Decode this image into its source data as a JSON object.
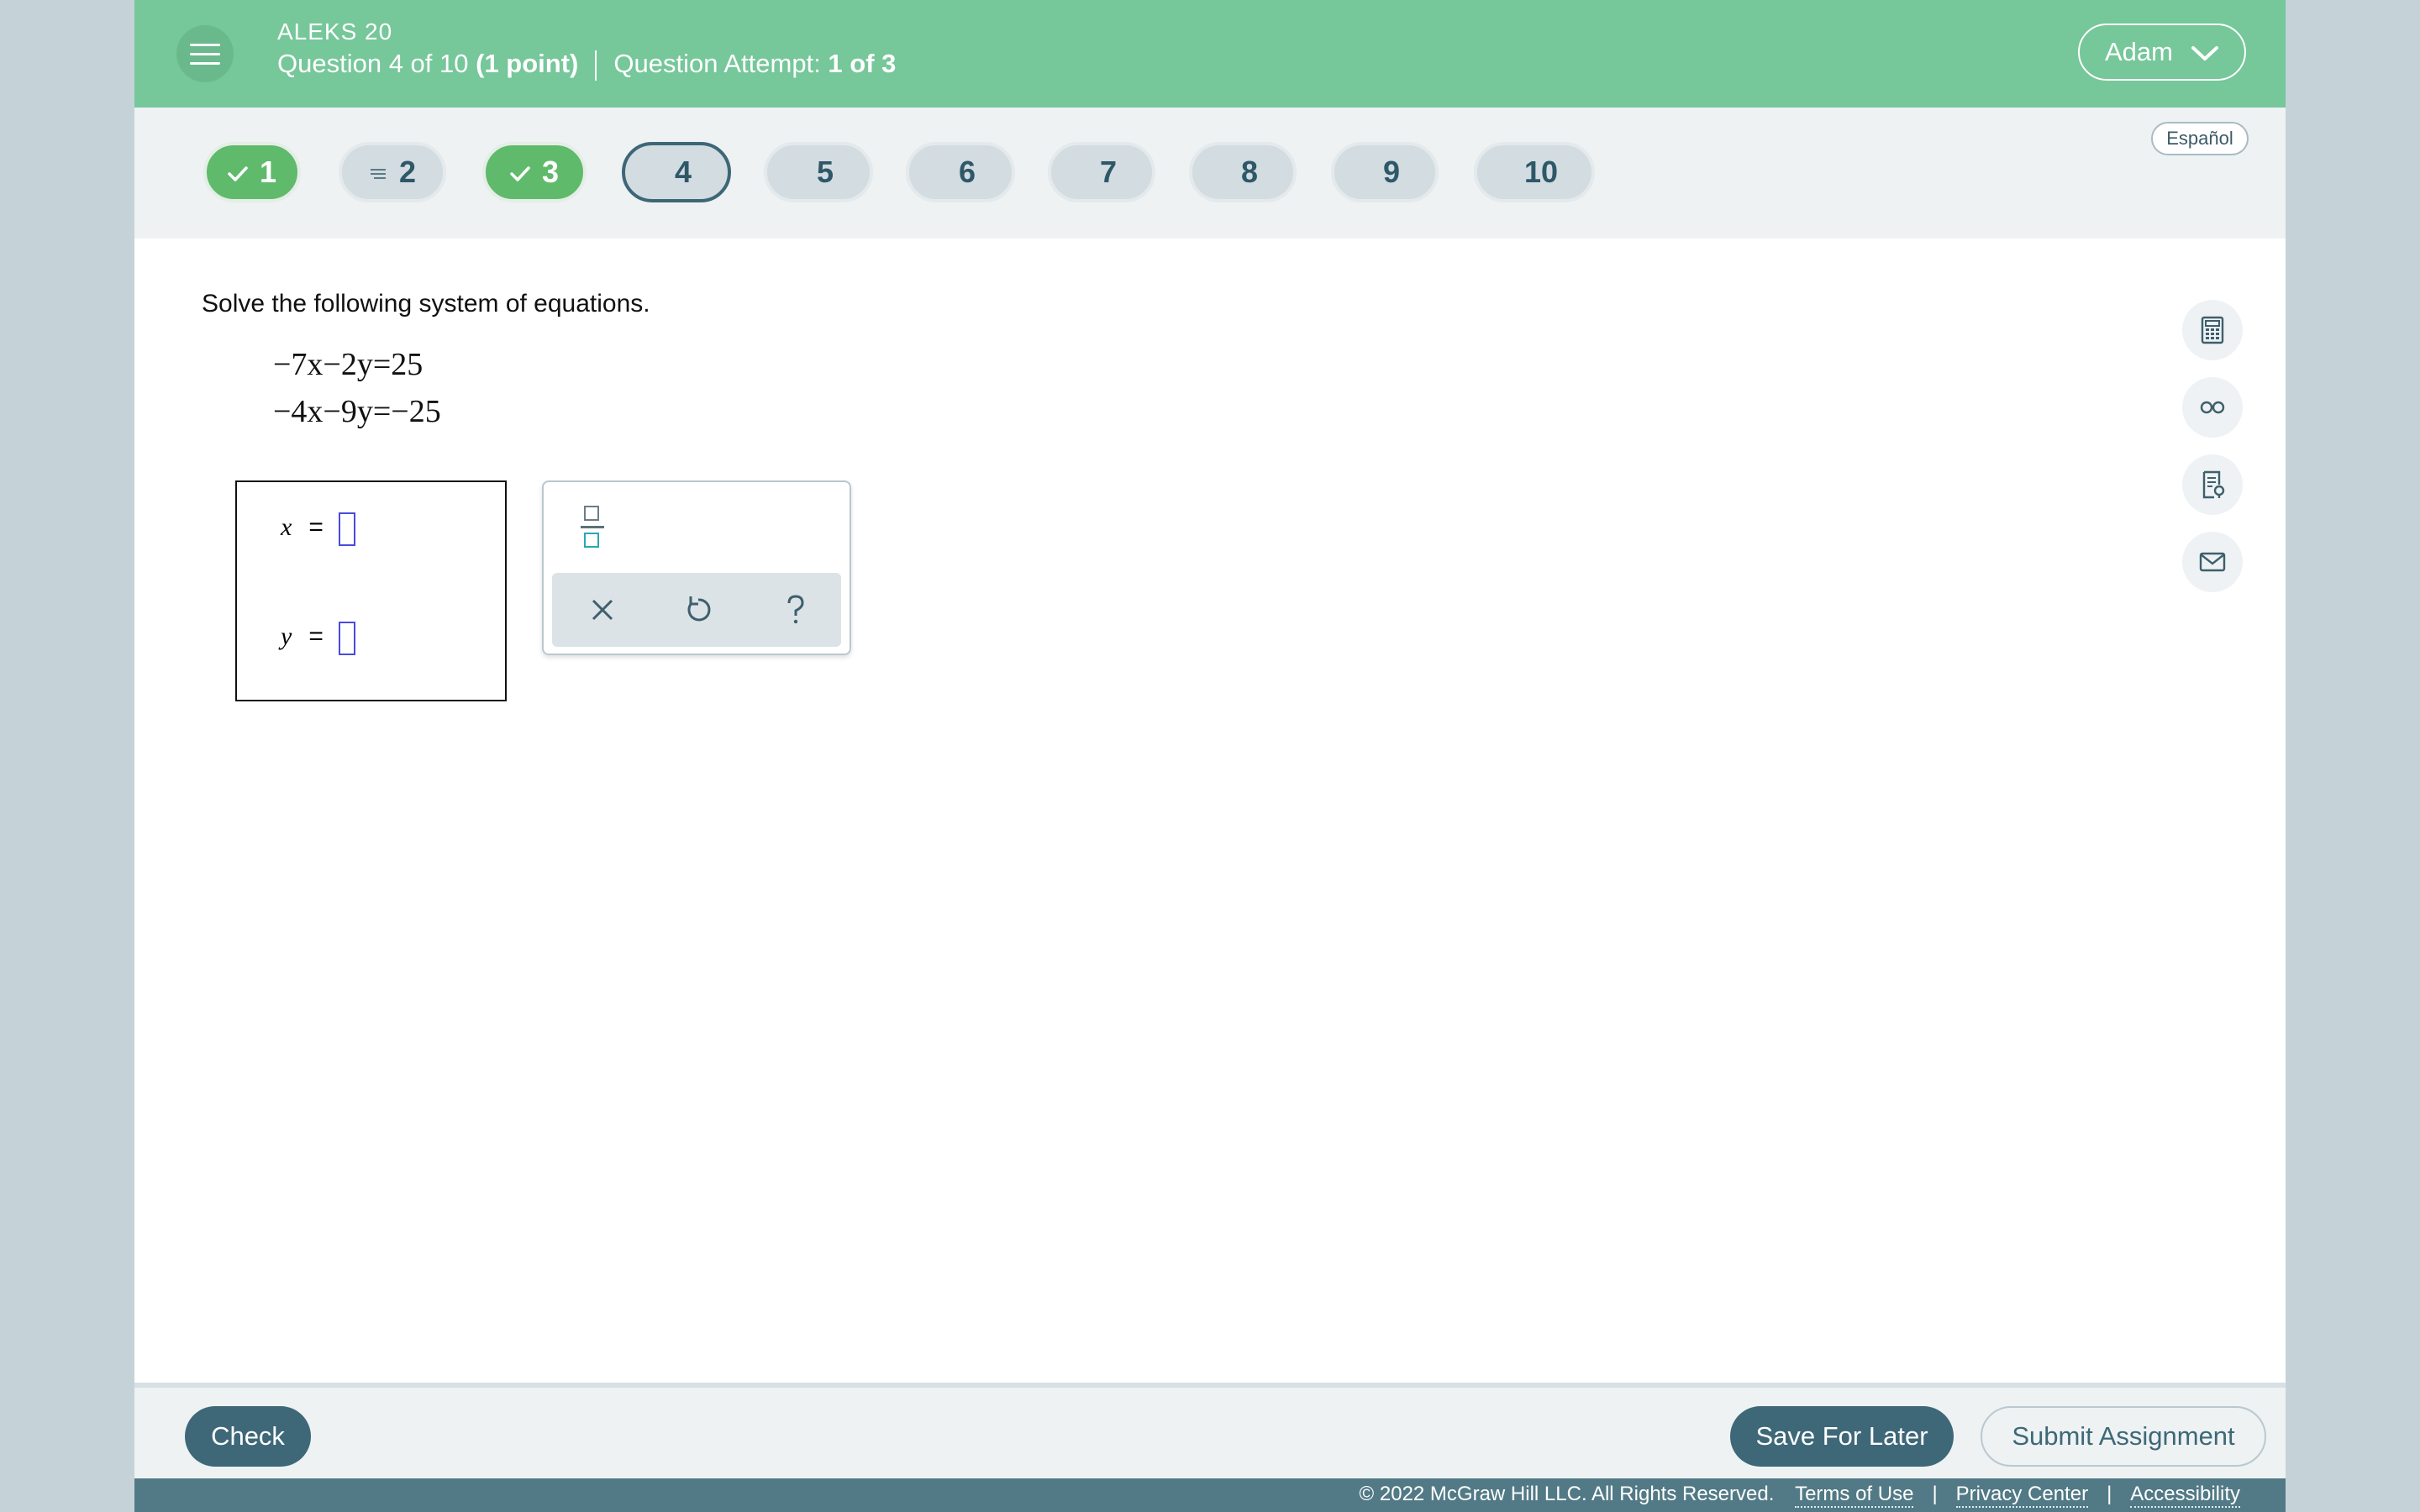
{
  "header": {
    "app_title": "ALEKS 20",
    "question_label": "Question 4 of 10",
    "points_label": "(1 point)",
    "attempt_label": "Question Attempt:",
    "attempt_value": "1 of 3",
    "user_name": "Adam",
    "menu_icon": "hamburger-icon",
    "bg_color": "#76c79a"
  },
  "question_nav": {
    "items": [
      {
        "label": "1",
        "status": "correct",
        "icon": "check-icon"
      },
      {
        "label": "2",
        "status": "partial",
        "icon": "list-lines-icon"
      },
      {
        "label": "3",
        "status": "correct",
        "icon": "check-icon"
      },
      {
        "label": "4",
        "status": "current"
      },
      {
        "label": "5",
        "status": "unanswered"
      },
      {
        "label": "6",
        "status": "unanswered"
      },
      {
        "label": "7",
        "status": "unanswered"
      },
      {
        "label": "8",
        "status": "unanswered"
      },
      {
        "label": "9",
        "status": "unanswered"
      },
      {
        "label": "10",
        "status": "unanswered"
      }
    ],
    "language_button": "Español"
  },
  "question": {
    "prompt": "Solve the following system of equations.",
    "equations": [
      "−7x−2y=25",
      "−4x−9y=−25"
    ],
    "answer_rows": [
      {
        "variable": "x",
        "sign": "=",
        "value": ""
      },
      {
        "variable": "y",
        "sign": "=",
        "value": ""
      }
    ]
  },
  "palette": {
    "fraction_icon": "fraction-icon",
    "actions": [
      "clear-icon",
      "undo-icon",
      "help-icon"
    ]
  },
  "tools": [
    "calculator-icon",
    "reading-glasses-icon",
    "textbook-icon",
    "message-icon"
  ],
  "footer": {
    "check_label": "Check",
    "save_label": "Save For Later",
    "submit_label": "Submit Assignment",
    "copyright": "© 2022 McGraw Hill LLC. All Rights Reserved.",
    "links": [
      "Terms of Use",
      "Privacy Center",
      "Accessibility"
    ]
  }
}
